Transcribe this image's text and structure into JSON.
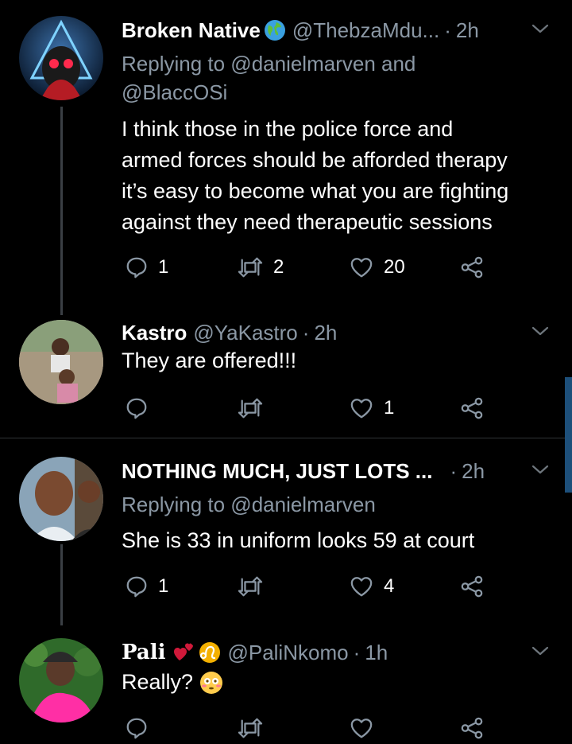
{
  "tweets": [
    {
      "name": "Broken Native",
      "name_emoji": "globe-icon",
      "handle": "@ThebzaMdu...",
      "dot": "·",
      "time": "2h",
      "replying": "Replying to @danielmarven and",
      "replying_line2": "@BlaccOSi",
      "body_lines": [
        "I think those in the police force and",
        "armed forces should be afforded therapy",
        "it’s easy to become what you are fighting",
        "against they need therapeutic sessions"
      ],
      "replies": "1",
      "retweets": "2",
      "likes": "20"
    },
    {
      "name": "Kastro",
      "handle": "@YaKastro",
      "dot": "·",
      "time": "2h",
      "body_lines": [
        "They are offered!!!"
      ],
      "replies": "",
      "retweets": "",
      "likes": "1"
    },
    {
      "name": "NOTHING MUCH, JUST LOTS ...",
      "handle": "",
      "dot": "·",
      "time": "2h",
      "replying": "Replying to @danielmarven",
      "body_lines": [
        "She is 33 in uniform looks 59 at court"
      ],
      "replies": "1",
      "retweets": "",
      "likes": "4"
    },
    {
      "name": "Pali",
      "name_emojis": [
        "two-hearts-icon",
        "leo-sign-icon"
      ],
      "handle": "@PaliNkomo",
      "dot": "·",
      "time": "1h",
      "body_lines": [
        "Really?"
      ],
      "body_emoji": "flushed-face-icon",
      "replies": "",
      "retweets": "",
      "likes": ""
    }
  ],
  "colors": {
    "background": "#000000",
    "secondary_text": "#8b98a5",
    "thread_line": "#3a3f44",
    "separator": "#2f3336",
    "scrollbar": "#1d4f7a"
  }
}
